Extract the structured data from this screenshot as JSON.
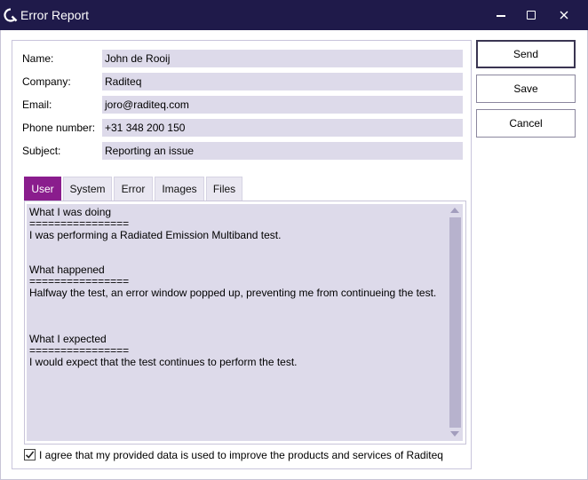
{
  "window": {
    "title": "Error Report",
    "icon": "raditeq-q-icon",
    "controls": [
      "minimize-icon",
      "maximize-icon",
      "close-icon"
    ]
  },
  "form": {
    "name_label": "Name:",
    "name_value": "John de Rooij",
    "company_label": "Company:",
    "company_value": "Raditeq",
    "email_label": "Email:",
    "email_value": "joro@raditeq.com",
    "phone_label": "Phone number:",
    "phone_value": "+31 348 200 150",
    "subject_label": "Subject:",
    "subject_value": "Reporting an issue"
  },
  "tabs": [
    {
      "label": "User",
      "active": true
    },
    {
      "label": "System",
      "active": false
    },
    {
      "label": "Error",
      "active": false
    },
    {
      "label": "Images",
      "active": false
    },
    {
      "label": "Files",
      "active": false
    }
  ],
  "report_text": "What I was doing\n================\nI was performing a Radiated Emission Multiband test.\n\n\nWhat happened\n================\nHalfway the test, an error window popped up, preventing me from continueing the test.\n\n\n\nWhat I expected\n================\nI would expect that the test continues to perform the test.",
  "consent": {
    "checked": true,
    "label": "I agree that my provided data is used to improve the products and services of Raditeq"
  },
  "buttons": {
    "send": "Send",
    "save": "Save",
    "cancel": "Cancel"
  },
  "colors": {
    "titlebar": "#1f1a4a",
    "accent_tab": "#8a1d8d",
    "field_bg": "#dddaea"
  }
}
